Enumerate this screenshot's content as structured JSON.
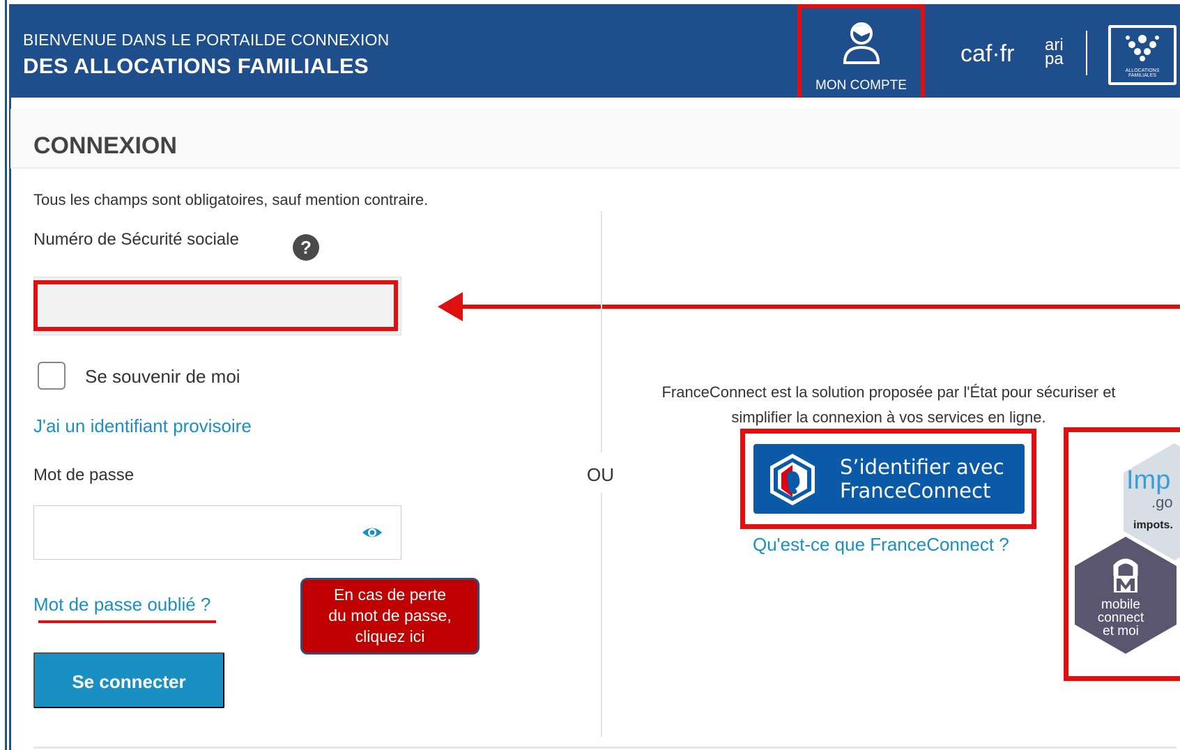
{
  "header": {
    "title_line1": "BIENVENUE DANS LE PORTAILDE CONNEXION",
    "title_line2": "DES ALLOCATIONS FAMILIALES",
    "account_label": "MON COMPTE",
    "caf_logo_text": "caf·fr",
    "aripa_top": "ari",
    "aripa_bottom": "pa",
    "seal_text": "ALLOCATIONS FAMILIALES",
    "bg_color": "#1f4e8c"
  },
  "login": {
    "section_title": "CONNEXION",
    "required_note": "Tous les champs sont obligatoires, sauf mention contraire.",
    "ssn_label": "Numéro de Sécurité sociale",
    "help_symbol": "?",
    "ssn_value": "",
    "remember_label": "Se souvenir de moi",
    "remember_checked": false,
    "temp_id_link": "J'ai un identifiant provisoire",
    "password_label": "Mot de passe",
    "password_value": "",
    "forgot_link": "Mot de passe oublié ?",
    "submit_label": "Se connecter",
    "link_color": "#1a8fc2"
  },
  "callout": {
    "text_line1": "En cas de perte",
    "text_line2": "du mot de passe,",
    "text_line3": "cliquez ici"
  },
  "separator": {
    "or_label": "OU"
  },
  "franceconnect": {
    "description_line1": "FranceConnect est la solution proposée par l'État pour sécuriser et",
    "description_line2": "simplifier la connexion à vos services en ligne.",
    "button_line1": "S’identifier avec",
    "button_line2": "FranceConnect",
    "what_link": "Qu'est-ce que FranceConnect ?"
  },
  "alternatives": {
    "impots_text": "Imp",
    "impots_sub": ".go",
    "impots_domain": "impots.",
    "mobile_connect_line1": "mobile",
    "mobile_connect_line2": "connect",
    "mobile_connect_line3": "et moi"
  },
  "annotations": {
    "highlight_color": "#e01010"
  }
}
